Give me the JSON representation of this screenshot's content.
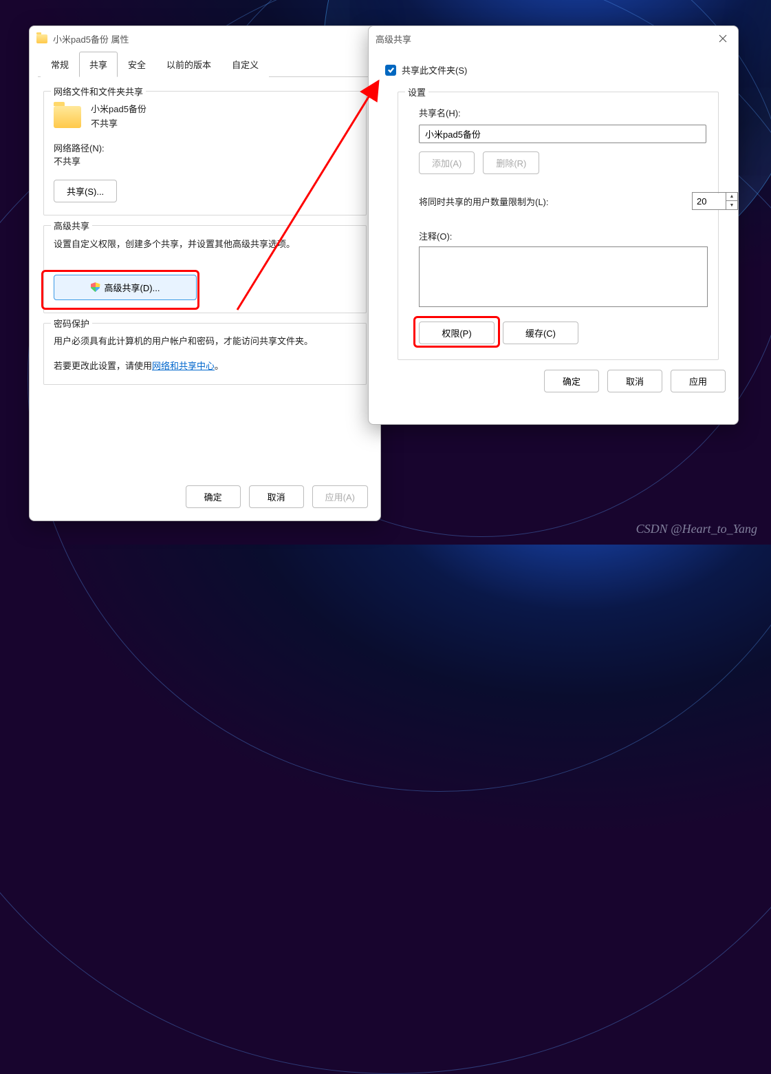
{
  "properties_dialog": {
    "title": "小米pad5备份 属性",
    "tabs": {
      "general": "常规",
      "sharing": "共享",
      "security": "安全",
      "previous": "以前的版本",
      "custom": "自定义"
    },
    "network_section": {
      "legend": "网络文件和文件夹共享",
      "folder_name": "小米pad5备份",
      "share_status": "不共享",
      "network_path_label": "网络路径(N):",
      "network_path_value": "不共享",
      "share_button": "共享(S)..."
    },
    "advanced_section": {
      "legend": "高级共享",
      "description": "设置自定义权限，创建多个共享，并设置其他高级共享选项。",
      "button": "高级共享(D)..."
    },
    "password_section": {
      "legend": "密码保护",
      "line1": "用户必须具有此计算机的用户帐户和密码，才能访问共享文件夹。",
      "line2_prefix": "若要更改此设置，请使用",
      "link_text": "网络和共享中心",
      "line2_suffix": "。"
    },
    "buttons": {
      "ok": "确定",
      "cancel": "取消",
      "apply": "应用(A)"
    }
  },
  "advanced_dialog": {
    "title": "高级共享",
    "share_checkbox": "共享此文件夹(S)",
    "settings_label": "设置",
    "share_name_label": "共享名(H):",
    "share_name_value": "小米pad5备份",
    "add_button": "添加(A)",
    "remove_button": "删除(R)",
    "user_limit_label": "将同时共享的用户数量限制为(L):",
    "user_limit_value": "20",
    "comment_label": "注释(O):",
    "permissions_button": "权限(P)",
    "cache_button": "缓存(C)",
    "buttons": {
      "ok": "确定",
      "cancel": "取消",
      "apply": "应用"
    }
  },
  "watermark": "CSDN @Heart_to_Yang"
}
